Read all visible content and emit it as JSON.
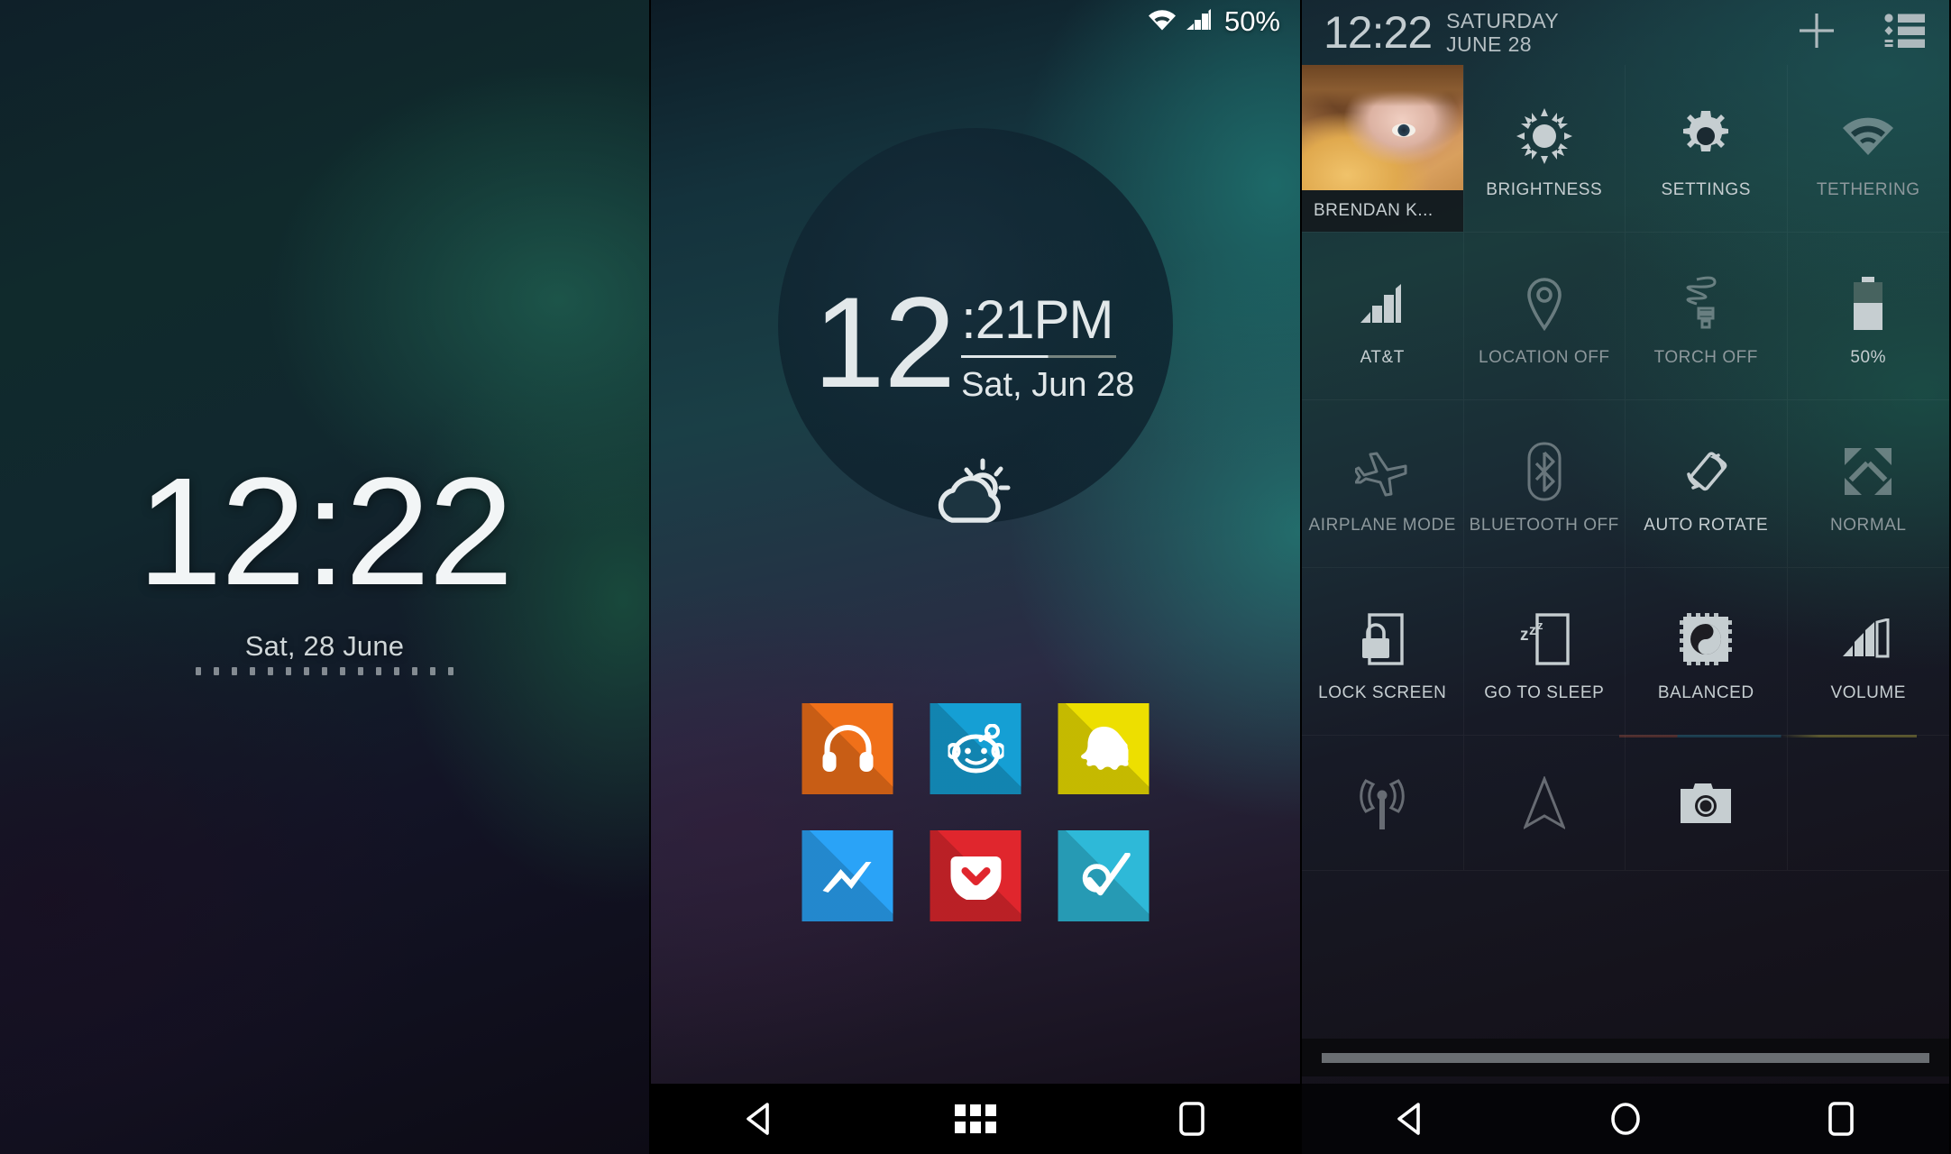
{
  "lockscreen": {
    "time": "12:22",
    "date": "Sat, 28 June",
    "pin_dot_count": 15
  },
  "homescreen": {
    "statusbar": {
      "wifi_icon": "wifi-icon",
      "signal_icon": "signal-bars-icon",
      "battery_percent": "50%"
    },
    "clock_widget": {
      "hour": "12",
      "minute_ampm": ":21PM",
      "date": "Sat, Jun 28",
      "weather_icon": "partly-cloudy-icon"
    },
    "apps": [
      {
        "name": "Play Music",
        "icon": "headphones-icon",
        "bg": "#f07019",
        "fg": "#ffffff"
      },
      {
        "name": "Reddit",
        "icon": "reddit-alien-icon",
        "bg": "#159fd4",
        "fg": "#ffffff"
      },
      {
        "name": "Snapchat",
        "icon": "ghost-icon",
        "bg": "#eddf00",
        "fg": "#ffffff"
      },
      {
        "name": "Messenger",
        "icon": "messenger-bolt-icon",
        "bg": "#2aa3f7",
        "fg": "#ffffff"
      },
      {
        "name": "Pocket",
        "icon": "pocket-icon",
        "bg": "#e0262d",
        "fg": "#ffffff"
      },
      {
        "name": "Wunderlist",
        "icon": "check-circle-icon",
        "bg": "#2eb9d8",
        "fg": "#ffffff"
      }
    ],
    "navbar": {
      "back": "back-triangle-icon",
      "apps": "app-drawer-icon",
      "recents": "recents-square-icon"
    }
  },
  "quicksettings": {
    "header": {
      "time": "12:22",
      "weekday": "SATURDAY",
      "date": "JUNE 28",
      "add_icon": "plus-icon",
      "list_icon": "list-menu-icon"
    },
    "tiles": [
      {
        "label": "BRENDAN K...",
        "icon": "user-avatar",
        "kind": "avatar",
        "state": "on"
      },
      {
        "label": "BRIGHTNESS",
        "icon": "sun-icon",
        "state": "on"
      },
      {
        "label": "SETTINGS",
        "icon": "gear-icon",
        "state": "on"
      },
      {
        "label": "TETHERING",
        "icon": "wifi-icon",
        "state": "off"
      },
      {
        "label": "AT&T",
        "icon": "signal-bars-icon",
        "state": "on"
      },
      {
        "label": "LOCATION OFF",
        "icon": "location-pin-icon",
        "state": "off"
      },
      {
        "label": "TORCH OFF",
        "icon": "lightbulb-icon",
        "state": "off"
      },
      {
        "label": "50%",
        "icon": "battery-icon",
        "state": "on"
      },
      {
        "label": "AIRPLANE MODE",
        "icon": "airplane-icon",
        "state": "off"
      },
      {
        "label": "BLUETOOTH OFF",
        "icon": "bluetooth-icon",
        "state": "off"
      },
      {
        "label": "AUTO ROTATE",
        "icon": "auto-rotate-icon",
        "state": "on"
      },
      {
        "label": "NORMAL",
        "icon": "expand-arrows-icon",
        "state": "off"
      },
      {
        "label": "LOCK SCREEN",
        "icon": "lock-icon",
        "state": "on"
      },
      {
        "label": "GO TO SLEEP",
        "icon": "sleep-zzz-icon",
        "state": "on"
      },
      {
        "label": "BALANCED",
        "icon": "yin-yang-chip-icon",
        "state": "on"
      },
      {
        "label": "VOLUME",
        "icon": "volume-bars-icon",
        "state": "on"
      }
    ],
    "partial_tiles": [
      {
        "label": "",
        "icon": "broadcast-antenna-icon",
        "state": "off"
      },
      {
        "label": "",
        "icon": "navigation-arrow-icon",
        "state": "off"
      },
      {
        "label": "",
        "icon": "camera-icon",
        "state": "on"
      },
      {
        "label": "",
        "icon": "",
        "state": "off"
      }
    ],
    "navbar": {
      "back": "back-triangle-icon",
      "home": "home-circle-icon",
      "recents": "recents-square-icon"
    }
  },
  "colors": {
    "accent_teal": "#2eb9d8",
    "text_primary": "#e2e8ea",
    "text_secondary": "#c6ced1",
    "text_dim": "#8d989c"
  }
}
